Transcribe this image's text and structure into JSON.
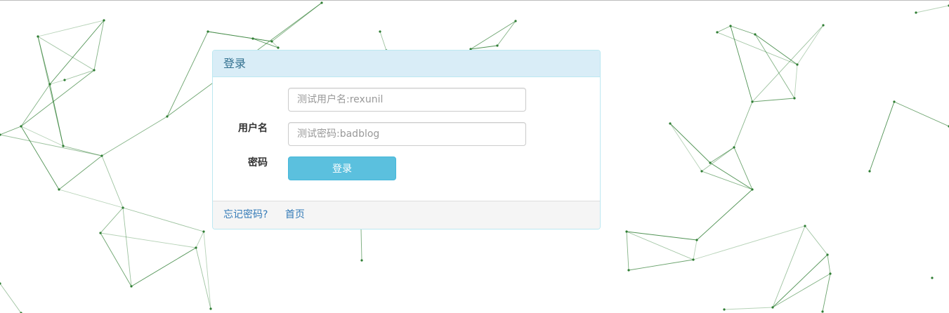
{
  "panel": {
    "title": "登录",
    "username_label": "用户名",
    "username_placeholder": "测试用户名:rexunil",
    "password_label": "密码",
    "password_placeholder": "测试密码:badblog",
    "submit_label": "登录"
  },
  "footer": {
    "forgot_password": "忘记密码?",
    "home": "首页"
  },
  "colors": {
    "heading_bg": "#d9edf7",
    "heading_text": "#31708f",
    "button_bg": "#5bc0de",
    "link": "#337ab7",
    "network_line": "#2e7d32"
  }
}
